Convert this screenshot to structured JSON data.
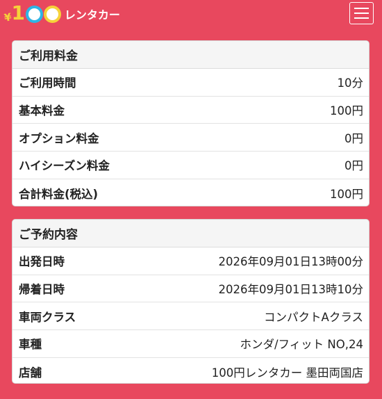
{
  "header": {
    "logo_yen": "¥",
    "logo_digit": "1",
    "logo_text": "レンタカー"
  },
  "fees": {
    "title": "ご利用料金",
    "rows": [
      {
        "label": "ご利用時間",
        "value": "10分"
      },
      {
        "label": "基本料金",
        "value": "100円"
      },
      {
        "label": "オプション料金",
        "value": "0円"
      },
      {
        "label": "ハイシーズン料金",
        "value": "0円"
      },
      {
        "label": "合計料金(税込)",
        "value": "100円"
      }
    ]
  },
  "booking": {
    "title": "ご予約内容",
    "rows": [
      {
        "label": "出発日時",
        "value": "2026年09月01日13時00分"
      },
      {
        "label": "帰着日時",
        "value": "2026年09月01日13時10分"
      },
      {
        "label": "車両クラス",
        "value": "コンパクトAクラス"
      },
      {
        "label": "車種",
        "value": "ホンダ/フィット NO,24"
      },
      {
        "label": "店舗",
        "value": "100円レンタカー 墨田両国店"
      }
    ]
  },
  "colors": {
    "background": "#e8485e",
    "logo_yellow": "#f6d23a",
    "logo_blue": "#2fb5e6"
  },
  "icons": {
    "menu": "hamburger-menu-icon"
  }
}
